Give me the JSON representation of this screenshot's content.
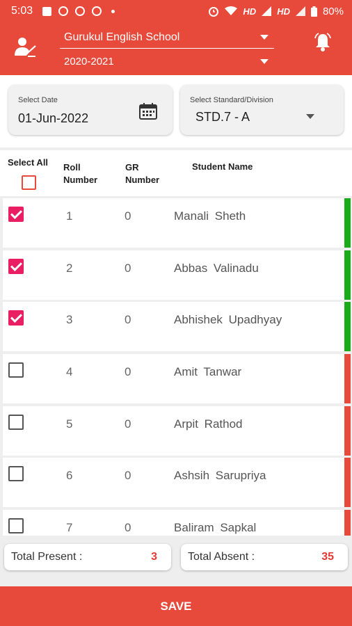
{
  "status_bar": {
    "time": "5:03",
    "network_1": "HD",
    "network_2": "HD",
    "battery": "80%"
  },
  "header": {
    "school": "Gurukul English School",
    "year": "2020-2021"
  },
  "filters": {
    "date_label": "Select Date",
    "date_value": "01-Jun-2022",
    "standard_label": "Select Standard/Division",
    "standard_value": "STD.7 - A"
  },
  "table": {
    "select_all": "Select All",
    "roll_header_1": "Roll",
    "roll_header_2": "Number",
    "gr_header_1": "GR",
    "gr_header_2": "Number",
    "name_header": "Student Name",
    "rows": [
      {
        "checked": true,
        "roll": "1",
        "gr": "0",
        "name": "Manali Sheth"
      },
      {
        "checked": true,
        "roll": "2",
        "gr": "0",
        "name": "Abbas Valinadu"
      },
      {
        "checked": true,
        "roll": "3",
        "gr": "0",
        "name": "Abhishek Upadhyay"
      },
      {
        "checked": false,
        "roll": "4",
        "gr": "0",
        "name": "Amit Tanwar"
      },
      {
        "checked": false,
        "roll": "5",
        "gr": "0",
        "name": "Arpit Rathod"
      },
      {
        "checked": false,
        "roll": "6",
        "gr": "0",
        "name": "Ashsih Sarupriya"
      },
      {
        "checked": false,
        "roll": "7",
        "gr": "0",
        "name": "Baliram Sapkal"
      }
    ]
  },
  "totals": {
    "present_label": "Total Present :",
    "present_value": "3",
    "absent_label": "Total Absent :",
    "absent_value": "35"
  },
  "save_label": "SAVE",
  "colors": {
    "primary": "#e74a3b",
    "checked": "#e91e63",
    "present_strip": "#1aaa1a",
    "absent_strip": "#e74a3b",
    "total_value": "#e53935"
  },
  "icons": {
    "teacher": "teacher-icon",
    "bell": "bell-icon",
    "calendar": "calendar-icon"
  }
}
